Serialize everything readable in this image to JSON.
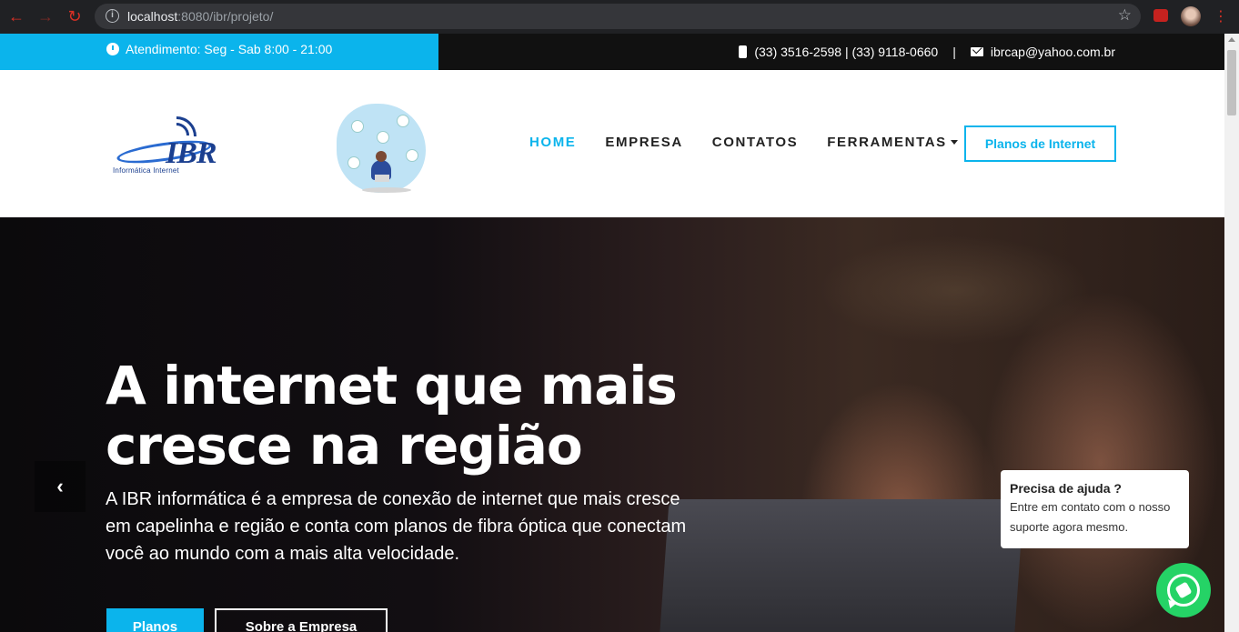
{
  "browser": {
    "url_host": "localhost",
    "url_rest": ":8080/ibr/projeto/"
  },
  "topbar": {
    "hours": "Atendimento: Seg - Sab 8:00 - 21:00",
    "phones": "(33) 3516-2598 | (33) 9118-0660",
    "separator": "|",
    "email": "ibrcap@yahoo.com.br"
  },
  "logo": {
    "letters": "IBR",
    "tagline": "Informática  Internet"
  },
  "nav": {
    "items": [
      {
        "label": "HOME"
      },
      {
        "label": "EMPRESA"
      },
      {
        "label": "CONTATOS"
      },
      {
        "label": "FERRAMENTAS"
      }
    ],
    "cta": "Planos de Internet"
  },
  "hero": {
    "title": "A internet que mais cresce na região",
    "text": "A IBR informática é a empresa de conexão de internet que mais cresce em capelinha e região e conta com planos de fibra óptica que conectam você ao mundo com a mais alta velocidade.",
    "btn_primary": "Planos",
    "btn_secondary": "Sobre a Empresa",
    "prev_icon": "‹"
  },
  "help": {
    "title": "Precisa de ajuda ?",
    "text": "Entre em contato com o nosso suporte agora mesmo."
  },
  "colors": {
    "accent": "#0bb4ec",
    "whatsapp": "#25d366"
  }
}
